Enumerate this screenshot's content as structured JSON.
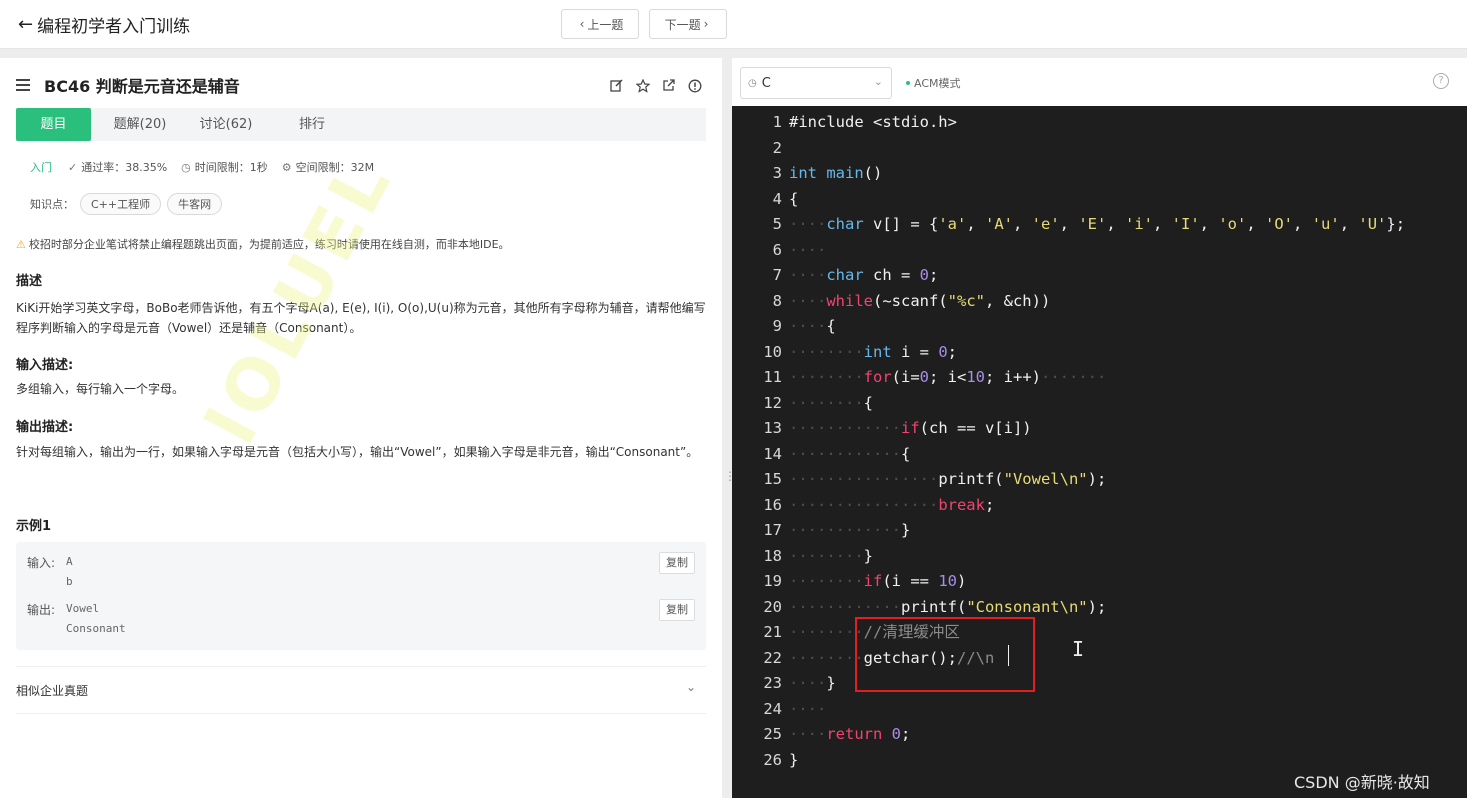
{
  "header": {
    "back_label": "编程初学者入门训练",
    "prev_label": "上一题",
    "next_label": "下一题"
  },
  "problem": {
    "title": "BC46  判断是元音还是辅音",
    "tabs": [
      "题目",
      "题解(20)",
      "讨论(62)",
      "排行"
    ],
    "level": "入门",
    "pass_rate": "通过率：38.35%",
    "time_limit": "时间限制：1秒",
    "space_limit": "空间限制：32M",
    "knowledge_label": "知识点：",
    "tags": [
      "C++工程师",
      "牛客网"
    ],
    "warning": "校招时部分企业笔试将禁止编程题跳出页面，为提前适应，练习时请使用在线自测，而非本地IDE。",
    "desc_title": "描述",
    "desc_text": "KiKi开始学习英文字母，BoBo老师告诉他，有五个字母A(a), E(e), I(i), O(o),U(u)称为元音，其他所有字母称为辅音，请帮他编写程序判断输入的字母是元音（Vowel）还是辅音（Consonant）。",
    "input_title": "输入描述:",
    "input_text": "多组输入，每行输入一个字母。",
    "output_title": "输出描述:",
    "output_text": "针对每组输入，输出为一行，如果输入字母是元音（包括大小写），输出“Vowel”，如果输入字母是非元音，输出“Consonant”。",
    "example_title": "示例1",
    "example": {
      "input_label": "输入:",
      "input_lines": [
        "A",
        "b"
      ],
      "output_label": "输出:",
      "output_lines": [
        "Vowel",
        "Consonant"
      ],
      "copy_label": "复制"
    },
    "similar_label": "相似企业真题",
    "watermark": "lOLUEL"
  },
  "editor": {
    "language": "C",
    "mode": "ACM模式",
    "help": "?",
    "line_numbers": [
      "1",
      "2",
      "3",
      "4",
      "5",
      "6",
      "7",
      "8",
      "9",
      "10",
      "11",
      "12",
      "13",
      "14",
      "15",
      "16",
      "17",
      "18",
      "19",
      "20",
      "21",
      "22",
      "23",
      "24",
      "25",
      "26"
    ]
  },
  "overlay": {
    "csdn_watermark": "CSDN @新晓·故知"
  },
  "colors": {
    "accent": "#2bbf7e",
    "editor_bg": "#1e1e1e",
    "highlight_box": "#e02020"
  }
}
